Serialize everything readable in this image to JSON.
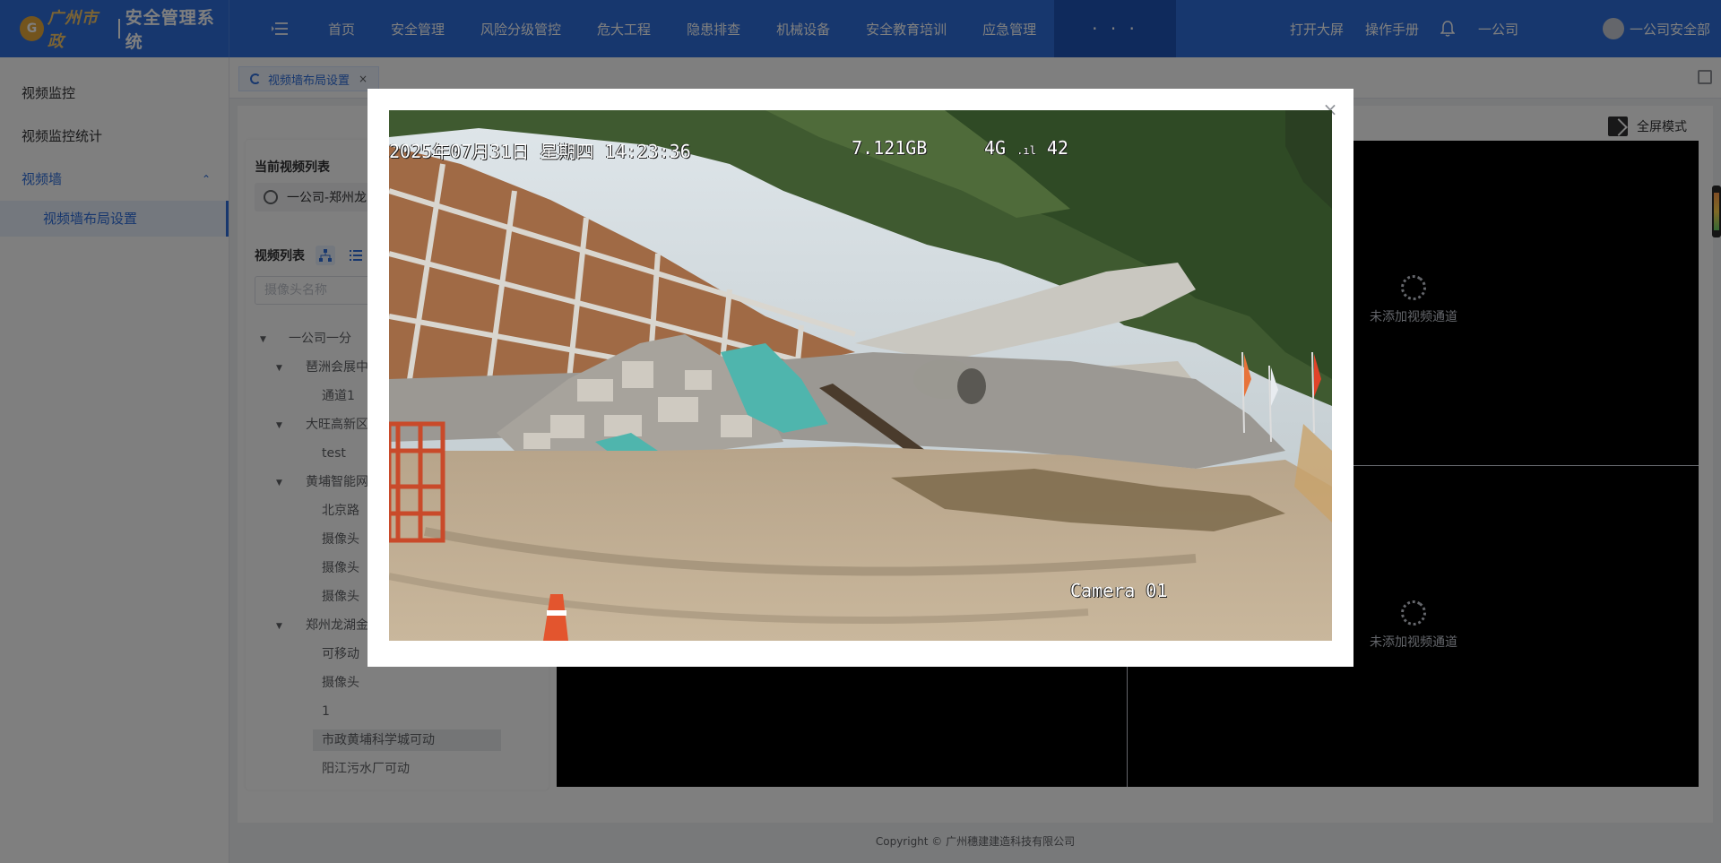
{
  "app": {
    "logo_text": "广州市政",
    "system_title": "安全管理系统"
  },
  "nav": {
    "items": [
      "首页",
      "安全管理",
      "风险分级管控",
      "危大工程",
      "隐患排查",
      "机械设备",
      "安全教育培训",
      "应急管理"
    ],
    "more": "· · ·"
  },
  "top_right": {
    "open_big_screen": "打开大屏",
    "manual": "操作手册",
    "company": "一公司",
    "user_name": "一公司安全部"
  },
  "sidebar": {
    "items": [
      "视频监控",
      "视频监控统计",
      "视频墙"
    ],
    "sub_item": "视频墙布局设置"
  },
  "tabs": {
    "active": "视频墙布局设置"
  },
  "panel": {
    "current_list_title": "当前视频列表",
    "current_video": "一公司-郑州龙",
    "video_list_title": "视频列表",
    "search_placeholder": "摄像头名称",
    "tree": [
      "一公司一分",
      "琶洲会展中",
      "通道1",
      "大旺高新区",
      "test",
      "黄埔智能网",
      "北京路",
      "摄像头",
      "摄像头",
      "摄像头",
      "郑州龙湖金",
      "可移动",
      "摄像头",
      "1",
      "市政黄埔科学城可动",
      "阳江污水厂可动"
    ]
  },
  "wall": {
    "fullscreen_label": "全屏模式",
    "empty_label_top": "未添加视频通道",
    "empty_label_bottom": "未添加视频通道"
  },
  "footer": {
    "copyright": "Copyright © 广州穗建建造科技有限公司"
  },
  "player": {
    "osd_datetime": "2025年07月31日  星期四  14:23:36",
    "osd_storage": "7.121GB",
    "osd_signal": "4G",
    "osd_signal_value": "42",
    "osd_camera": "Camera 01"
  },
  "colors": {
    "primary": "#2f6fdc",
    "topbar": "#2f6fdc",
    "overlay": "rgba(0,0,0,0.5)"
  }
}
